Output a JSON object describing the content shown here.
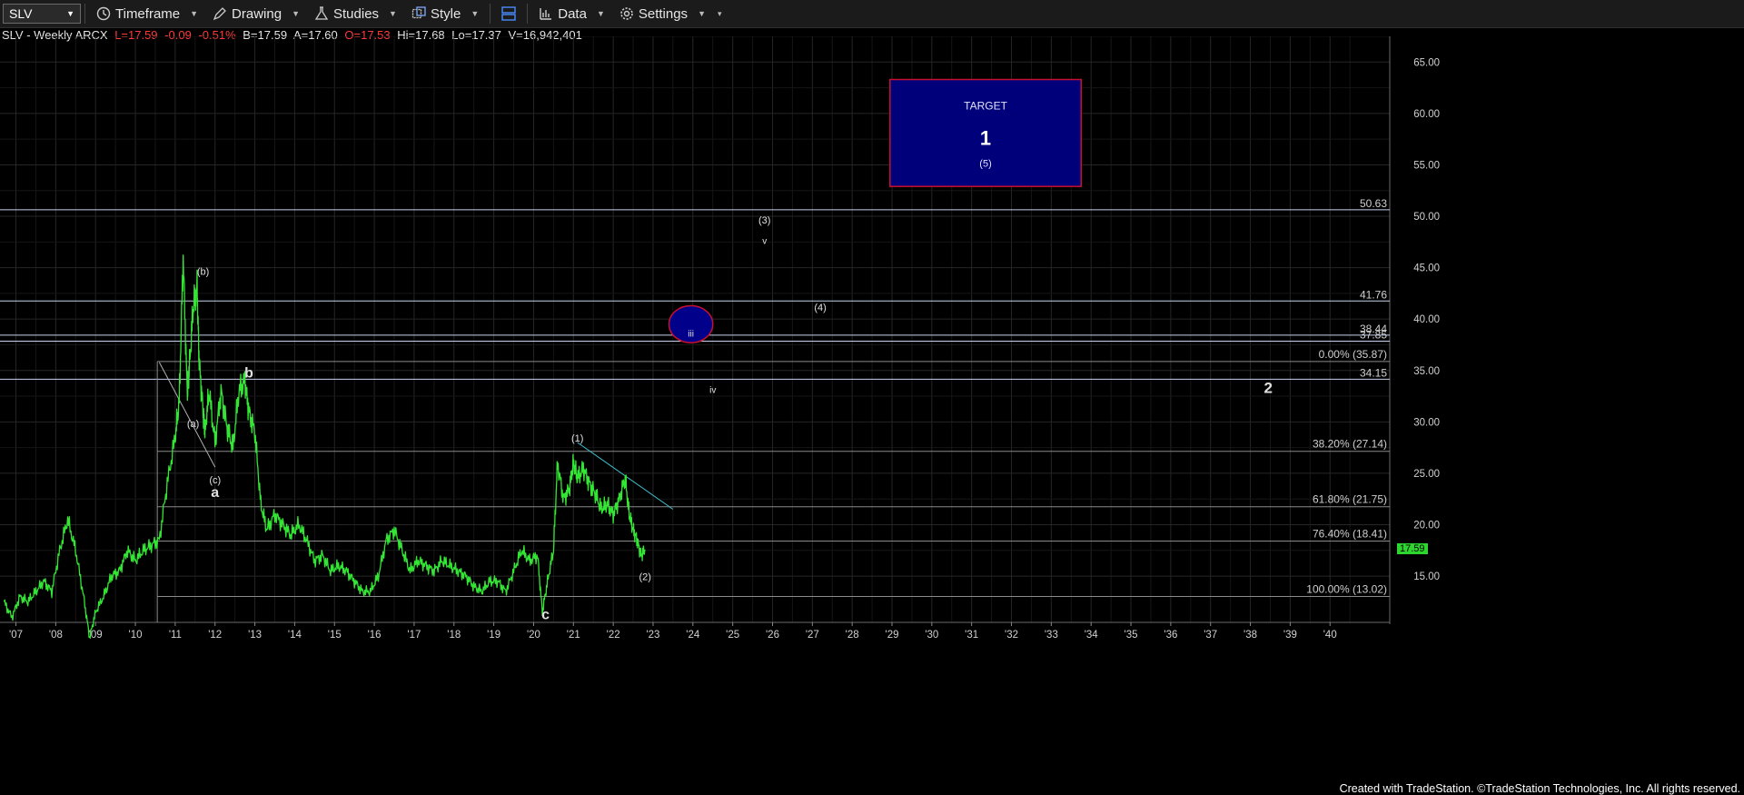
{
  "toolbar": {
    "symbol": "SLV",
    "items": [
      "Timeframe",
      "Drawing",
      "Studies",
      "Style",
      "Data",
      "Settings"
    ]
  },
  "info": {
    "title": "SLV - Weekly  ARCX",
    "last": "L=17.59",
    "change": "-0.09",
    "pct": "-0.51%",
    "bid": "B=17.59",
    "ask": "A=17.60",
    "open": "O=17.53",
    "high": "Hi=17.68",
    "low": "Lo=17.37",
    "volume": "V=16,942,401",
    "colors": {
      "down": "#ff3b3b",
      "normal": "#e6e6e6"
    }
  },
  "chart_data": {
    "type": "line",
    "series": [
      {
        "x": [
          2006.7,
          2006.9,
          2007.1,
          2007.3,
          2007.5,
          2007.7,
          2007.9,
          2008.1,
          2008.3,
          2008.5,
          2008.7,
          2008.85,
          2009.0,
          2009.2,
          2009.4,
          2009.6,
          2009.8,
          2010.0,
          2010.2,
          2010.4,
          2010.6,
          2010.8,
          2011.0,
          2011.1,
          2011.2,
          2011.3,
          2011.35,
          2011.45,
          2011.55,
          2011.6,
          2011.7,
          2011.75,
          2011.85,
          2012.0,
          2012.15,
          2012.3,
          2012.45,
          2012.6,
          2012.75,
          2012.85,
          2013.0,
          2013.15,
          2013.3,
          2013.5,
          2013.7,
          2013.9,
          2014.1,
          2014.3,
          2014.5,
          2014.7,
          2014.9,
          2015.1,
          2015.3,
          2015.5,
          2015.7,
          2015.9,
          2016.1,
          2016.3,
          2016.5,
          2016.7,
          2016.9,
          2017.1,
          2017.3,
          2017.5,
          2017.7,
          2017.9,
          2018.1,
          2018.3,
          2018.5,
          2018.7,
          2018.9,
          2019.1,
          2019.3,
          2019.5,
          2019.7,
          2019.9,
          2020.1,
          2020.22,
          2020.35,
          2020.5,
          2020.6,
          2020.75,
          2020.9,
          2021.0,
          2021.1,
          2021.25,
          2021.4,
          2021.55,
          2021.7,
          2021.85,
          2022.0,
          2022.15,
          2022.3,
          2022.4,
          2022.5,
          2022.6,
          2022.7,
          2022.8
        ],
        "y": [
          12.5,
          11.0,
          13.0,
          12.5,
          13.5,
          14.5,
          13.5,
          17.5,
          20.5,
          17.5,
          13.0,
          9.0,
          11.5,
          13.0,
          15.0,
          15.5,
          17.5,
          16.5,
          17.5,
          18.0,
          18.5,
          24.0,
          28.5,
          32.0,
          46.0,
          33.0,
          35.0,
          41.0,
          43.0,
          36.0,
          31.0,
          29.0,
          33.0,
          28.0,
          33.0,
          29.5,
          27.5,
          33.0,
          34.0,
          31.0,
          29.0,
          22.0,
          19.5,
          21.0,
          20.0,
          19.0,
          20.0,
          18.5,
          16.5,
          17.0,
          15.5,
          16.0,
          15.5,
          14.5,
          13.5,
          13.5,
          15.0,
          18.5,
          19.5,
          17.5,
          15.5,
          16.5,
          16.0,
          15.5,
          16.5,
          16.0,
          15.5,
          15.0,
          14.0,
          13.5,
          14.5,
          14.5,
          13.5,
          15.5,
          17.5,
          16.5,
          17.0,
          11.5,
          14.5,
          17.5,
          26.0,
          22.5,
          23.5,
          26.0,
          24.5,
          25.5,
          24.0,
          23.0,
          21.5,
          22.0,
          21.0,
          22.5,
          24.5,
          21.0,
          19.5,
          18.5,
          17.0,
          17.59
        ],
        "color": "#34e634"
      }
    ],
    "xlim": [
      2006.6,
      2041.5
    ],
    "ylim": [
      10.5,
      67.5
    ],
    "x_ticks": [
      "'07",
      "'08",
      "'09",
      "'10",
      "'11",
      "'12",
      "'13",
      "'14",
      "'15",
      "'16",
      "'17",
      "'18",
      "'19",
      "'20",
      "'21",
      "'22",
      "'23",
      "'24",
      "'25",
      "'26",
      "'27",
      "'28",
      "'29",
      "'30",
      "'31",
      "'32",
      "'33",
      "'34",
      "'35",
      "'36",
      "'37",
      "'38",
      "'39",
      "'40"
    ],
    "y_ticks": [
      "15.00",
      "20.00",
      "25.00",
      "30.00",
      "35.00",
      "40.00",
      "45.00",
      "50.00",
      "55.00",
      "60.00",
      "65.00"
    ],
    "last_price": "17.59",
    "horizontal_levels": [
      {
        "value": 50.63,
        "label": "50.63"
      },
      {
        "value": 41.76,
        "label": "41.76"
      },
      {
        "value": 38.44,
        "label": "38.44"
      },
      {
        "value": 37.85,
        "label": "37.85"
      },
      {
        "value": 34.15,
        "label": "34.15"
      }
    ],
    "fib_levels": [
      {
        "value": 35.87,
        "label": "0.00% (35.87)"
      },
      {
        "value": 27.14,
        "label": "38.20% (27.14)"
      },
      {
        "value": 21.75,
        "label": "61.80% (21.75)"
      },
      {
        "value": 18.41,
        "label": "76.40% (18.41)"
      },
      {
        "value": 13.02,
        "label": "100.00% (13.02)"
      }
    ],
    "wave_labels": [
      {
        "text": "(b)",
        "x": 2011.7,
        "y": 44.3,
        "size": 11
      },
      {
        "text": "(a)",
        "x": 2011.45,
        "y": 29.5,
        "size": 11
      },
      {
        "text": "(c)",
        "x": 2012.0,
        "y": 24.0,
        "size": 11
      },
      {
        "text": "a",
        "x": 2012.0,
        "y": 22.7,
        "size": 16,
        "bold": true
      },
      {
        "text": "b",
        "x": 2012.85,
        "y": 34.3,
        "size": 16,
        "bold": true
      },
      {
        "text": "c",
        "x": 2020.3,
        "y": 10.8,
        "size": 16,
        "bold": true
      },
      {
        "text": "(1)",
        "x": 2021.1,
        "y": 28.1,
        "size": 11
      },
      {
        "text": "(2)",
        "x": 2022.8,
        "y": 14.6,
        "size": 11
      },
      {
        "text": "iii",
        "x": 2023.95,
        "y": 38.3,
        "size": 10
      },
      {
        "text": "iv",
        "x": 2024.5,
        "y": 32.8,
        "size": 10
      },
      {
        "text": "(3)",
        "x": 2025.8,
        "y": 49.3,
        "size": 11
      },
      {
        "text": "v",
        "x": 2025.8,
        "y": 47.3,
        "size": 10
      },
      {
        "text": "(4)",
        "x": 2027.2,
        "y": 40.8,
        "size": 11
      },
      {
        "text": "2",
        "x": 2038.45,
        "y": 32.8,
        "size": 17,
        "bold": true
      }
    ],
    "target_box": {
      "x0": 2028.95,
      "x1": 2033.75,
      "y0": 52.9,
      "y1": 63.3,
      "title": "TARGET",
      "number": "1",
      "sub": "(5)"
    },
    "ellipse": {
      "x": 2023.95,
      "y": 39.5,
      "rx_years": 0.55,
      "ry_price": 1.8
    },
    "fib_anchor": {
      "x": 2010.55,
      "y_top": 35.87,
      "y_bottom": 10.5
    },
    "trendlines": [
      {
        "x0": 2010.6,
        "y0": 35.8,
        "x1": 2012.0,
        "y1": 25.6
      },
      {
        "x0": 2021.1,
        "y0": 28.0,
        "x1": 2023.5,
        "y1": 21.5
      }
    ]
  },
  "credit": "Created with TradeStation. ©TradeStation Technologies, Inc. All rights reserved."
}
